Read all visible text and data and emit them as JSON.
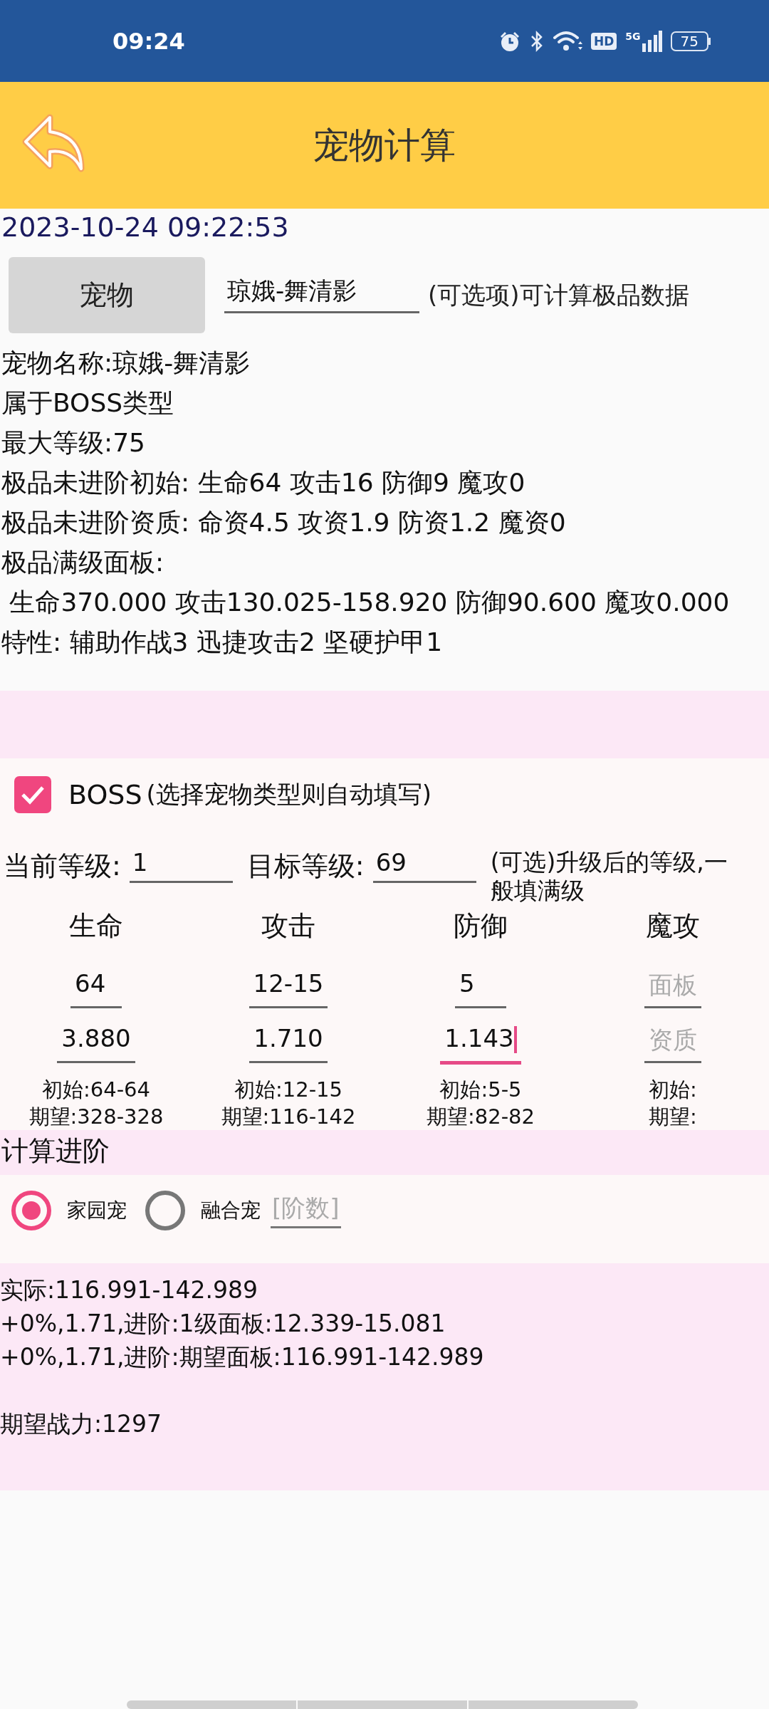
{
  "status_bar": {
    "time": "09:24",
    "hd": "HD",
    "network": "5G",
    "battery": "75"
  },
  "header": {
    "title": "宠物计算"
  },
  "timestamp": "2023-10-24 09:22:53",
  "pet_selector": {
    "button_label": "宠物",
    "value": "琼娥-舞清影",
    "hint": "(可选项)可计算极品数据"
  },
  "info_lines": [
    "宠物名称:琼娥-舞清影",
    "属于BOSS类型",
    "最大等级:75",
    "极品未进阶初始: 生命64 攻击16 防御9 魔攻0",
    "极品未进阶资质: 命资4.5 攻资1.9 防资1.2 魔资0",
    "极品满级面板:",
    " 生命370.000 攻击130.025-158.920 防御90.600 魔攻0.000",
    "特性: 辅助作战3 迅捷攻击2 坚硬护甲1"
  ],
  "boss_checkbox": {
    "label": "BOSS",
    "hint": "(选择宠物类型则自动填写)",
    "checked": true
  },
  "levels": [
    {
      "label": "当前等级:",
      "value": "1"
    },
    {
      "label": "目标等级:",
      "value": "69"
    }
  ],
  "level_hint": "(可选)升级后的等级,一般填满级",
  "stats": [
    {
      "name": "生命",
      "panel": {
        "value": "64"
      },
      "aptitude": {
        "value": "3.880",
        "focused": false
      },
      "initial": "初始:64-64",
      "expected": "期望:328-328"
    },
    {
      "name": "攻击",
      "panel": {
        "value": "12-15"
      },
      "aptitude": {
        "value": "1.710",
        "focused": false
      },
      "initial": "初始:12-15",
      "expected": "期望:116-142"
    },
    {
      "name": "防御",
      "panel": {
        "value": "5"
      },
      "aptitude": {
        "value": "1.143",
        "focused": true
      },
      "initial": "初始:5-5",
      "expected": "期望:82-82"
    },
    {
      "name": "魔攻",
      "panel": {
        "placeholder": "面板"
      },
      "aptitude": {
        "placeholder": "资质",
        "focused": false
      },
      "initial": "初始:",
      "expected": "期望:"
    }
  ],
  "advance": {
    "title": "计算进阶",
    "options": [
      {
        "label": "家园宠",
        "selected": true
      },
      {
        "label": "融合宠",
        "selected": false
      }
    ],
    "stage_placeholder": "[阶数]"
  },
  "results": [
    "实际:116.991-142.989",
    "+0%,1.71,进阶:1级面板:12.339-15.081",
    "+0%,1.71,进阶:期望面板:116.991-142.989"
  ],
  "power": "期望战力:1297"
}
